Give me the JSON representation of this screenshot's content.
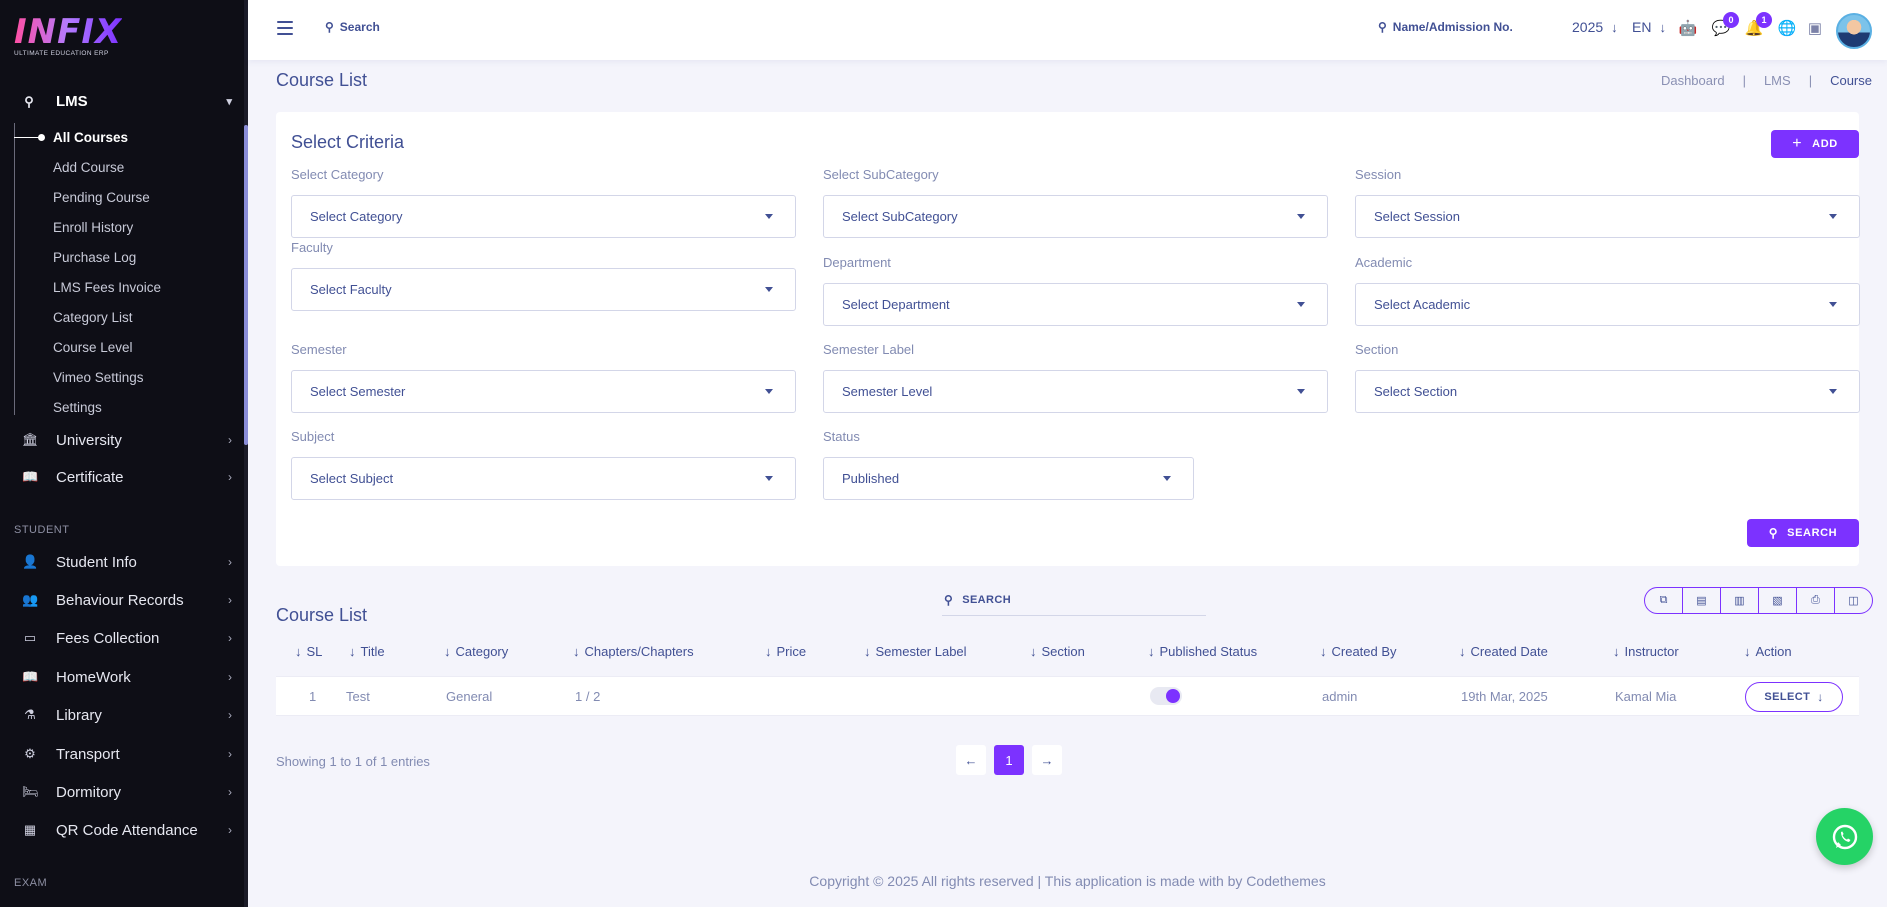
{
  "brand": {
    "logo_text": "INFIX",
    "tagline": "ULTIMATE EDUCATION ERP"
  },
  "sidebar": {
    "open_menu": {
      "label": "LMS",
      "icon": "lms-icon"
    },
    "sub_items": [
      {
        "label": "All Courses",
        "active": true
      },
      {
        "label": "Add Course"
      },
      {
        "label": "Pending Course"
      },
      {
        "label": "Enroll History"
      },
      {
        "label": "Purchase Log"
      },
      {
        "label": "LMS Fees Invoice"
      },
      {
        "label": "Category List"
      },
      {
        "label": "Course Level"
      },
      {
        "label": "Vimeo Settings"
      },
      {
        "label": "Settings"
      }
    ],
    "items_top": [
      {
        "label": "University",
        "icon": "university-icon"
      },
      {
        "label": "Certificate",
        "icon": "certificate-icon"
      }
    ],
    "student_section_label": "STUDENT",
    "student_items": [
      {
        "label": "Student Info",
        "icon": "student-icon"
      },
      {
        "label": "Behaviour Records",
        "icon": "behaviour-icon"
      },
      {
        "label": "Fees Collection",
        "icon": "fees-icon"
      },
      {
        "label": "HomeWork",
        "icon": "homework-icon"
      },
      {
        "label": "Library",
        "icon": "library-icon"
      },
      {
        "label": "Transport",
        "icon": "transport-icon"
      },
      {
        "label": "Dormitory",
        "icon": "dormitory-icon"
      },
      {
        "label": "QR Code Attendance",
        "icon": "qr-icon"
      }
    ],
    "exam_section_label": "EXAM"
  },
  "header": {
    "search_label": "Search",
    "admission_search_label": "Name/Admission No.",
    "year": "2025",
    "language": "EN",
    "messages_count": "0",
    "notifications_count": "1"
  },
  "page": {
    "title": "Course List",
    "breadcrumb": [
      "Dashboard",
      "LMS",
      "Course"
    ]
  },
  "criteria": {
    "title": "Select Criteria",
    "add_label": "ADD",
    "search_label": "SEARCH",
    "fields": {
      "category": {
        "label": "Select Category",
        "value": "Select Category"
      },
      "subcategory": {
        "label": "Select SubCategory",
        "value": "Select SubCategory"
      },
      "session": {
        "label": "Session",
        "value": "Select Session"
      },
      "faculty": {
        "label": "Faculty",
        "value": "Select Faculty"
      },
      "department": {
        "label": "Department",
        "value": "Select Department"
      },
      "academic": {
        "label": "Academic",
        "value": "Select Academic"
      },
      "semester": {
        "label": "Semester",
        "value": "Select Semester"
      },
      "semester_label": {
        "label": "Semester Label",
        "value": "Semester Level"
      },
      "section": {
        "label": "Section",
        "value": "Select Section"
      },
      "subject": {
        "label": "Subject",
        "value": "Select Subject"
      },
      "status": {
        "label": "Status",
        "value": "Published"
      }
    }
  },
  "course_table": {
    "title": "Course List",
    "search_placeholder": "SEARCH",
    "columns": [
      "SL",
      "Title",
      "Category",
      "Chapters/Chapters",
      "Price",
      "Semester Label",
      "Section",
      "Published Status",
      "Created By",
      "Created Date",
      "Instructor",
      "Action"
    ],
    "rows": [
      {
        "sl": "1",
        "title": "Test",
        "category": "General",
        "chapters": "1 / 2",
        "price": "",
        "semester_label": "",
        "section": "",
        "published": true,
        "created_by": "admin",
        "created_date": "19th Mar, 2025",
        "instructor": "Kamal Mia",
        "action_label": "SELECT"
      }
    ],
    "showing_text": "Showing 1 to 1 of 1 entries",
    "current_page": "1"
  },
  "footer": {
    "text": "Copyright © 2025 All rights reserved | This application is made with by Codethemes"
  },
  "colors": {
    "accent": "#7c32ff",
    "text": "#415094",
    "muted": "#828bb2",
    "sidebar_bg": "#0e0e16",
    "whatsapp": "#25d366"
  }
}
